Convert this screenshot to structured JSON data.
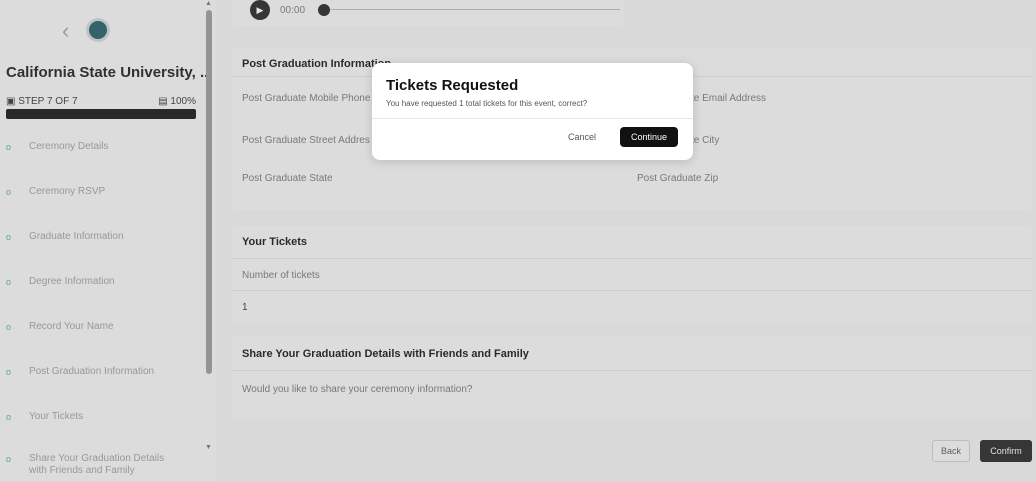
{
  "sidebar": {
    "university_name": "California State University, ...",
    "step_label": "STEP 7 OF 7",
    "progress_label": "100%",
    "progress": 1.0,
    "items": [
      {
        "label": "Ceremony Details"
      },
      {
        "label": "Ceremony RSVP"
      },
      {
        "label": "Graduate Information"
      },
      {
        "label": "Degree Information"
      },
      {
        "label": "Record Your Name"
      },
      {
        "label": "Post Graduation Information"
      },
      {
        "label": "Your Tickets"
      },
      {
        "label": "Share Your Graduation Details with Friends and Family"
      }
    ]
  },
  "audio": {
    "time": "00:00"
  },
  "post_graduation": {
    "title": "Post Graduation Information",
    "mobile_phone_label": "Post Graduate Mobile Phone",
    "email_label": "Post Graduate Email Address",
    "email_label_visible": "te Email Address",
    "street_label": "Post Graduate Street Address",
    "street_label_visible": "Post Graduate Street Addres",
    "city_label": "Post Graduate City",
    "city_label_visible": "te City",
    "state_label": "Post Graduate State",
    "zip_label": "Post Graduate Zip"
  },
  "tickets": {
    "title": "Your Tickets",
    "number_label": "Number of tickets",
    "number_value": "1"
  },
  "share": {
    "title": "Share Your Graduation Details with Friends and Family",
    "question": "Would you like to share your ceremony information?"
  },
  "footer": {
    "back_label": "Back",
    "confirm_label": "Confirm"
  },
  "modal": {
    "title": "Tickets Requested",
    "message": "You have requested 1 total tickets for this event, correct?",
    "cancel_label": "Cancel",
    "continue_label": "Continue"
  }
}
